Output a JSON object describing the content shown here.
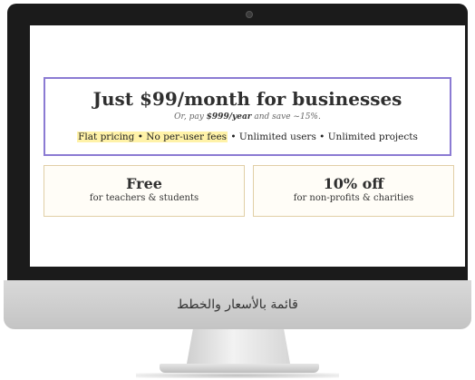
{
  "pricing": {
    "headline": "Just $99/month for businesses",
    "subline_prefix": "Or, pay ",
    "subline_bold": "$999/year",
    "subline_suffix": " and save ~15%.",
    "features_highlight": "Flat pricing • No per-user fees",
    "features_rest": " • Unlimited users • Unlimited projects"
  },
  "offers": {
    "free_title": "Free",
    "free_sub": "for teachers & students",
    "np_title": "10% off",
    "np_sub": "for non-profits & charities"
  },
  "monitor": {
    "caption": "قائمة بالأسعار والخطط"
  }
}
